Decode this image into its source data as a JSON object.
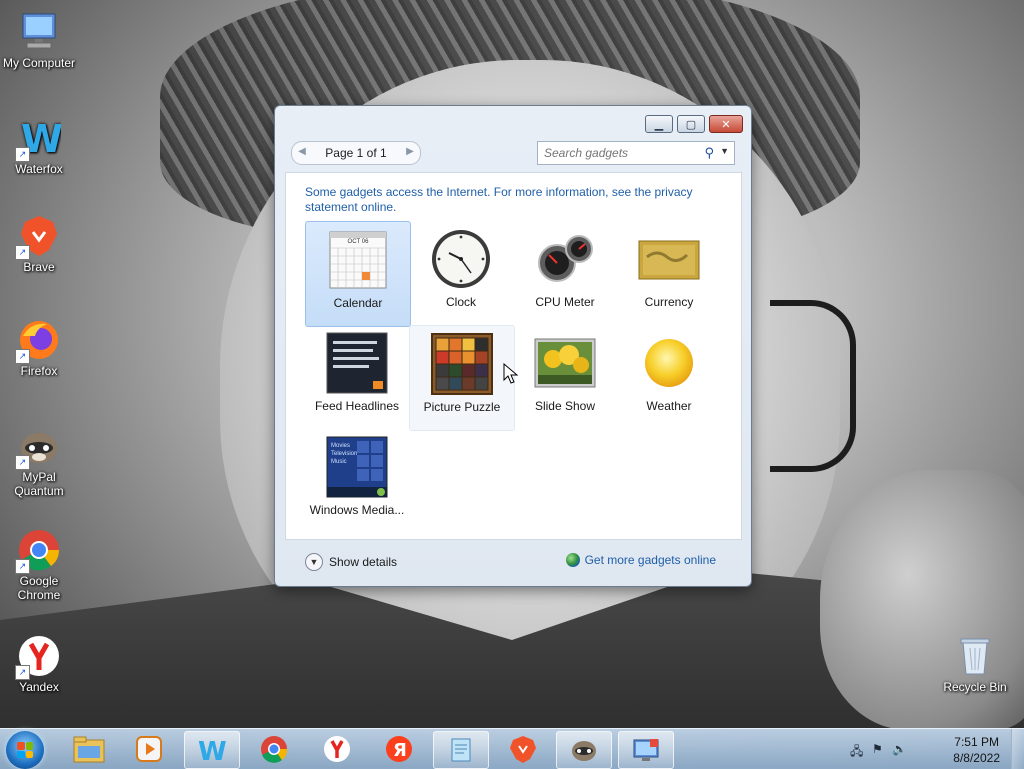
{
  "desktop": {
    "icons": [
      {
        "label": "My Computer"
      },
      {
        "label": "Waterfox"
      },
      {
        "label": "Brave"
      },
      {
        "label": "Firefox"
      },
      {
        "label": "MyPal Quantum"
      },
      {
        "label": "Google Chrome"
      },
      {
        "label": "Yandex"
      },
      {
        "label": "Recycle Bin"
      }
    ]
  },
  "gadget_window": {
    "pager": {
      "label": "Page 1 of 1"
    },
    "search": {
      "placeholder": "Search gadgets"
    },
    "info_text": "Some gadgets access the Internet.  For more information, see the privacy statement online.",
    "gadgets": [
      {
        "label": "Calendar",
        "icon": "calendar-icon",
        "selected": true
      },
      {
        "label": "Clock",
        "icon": "clock-icon"
      },
      {
        "label": "CPU Meter",
        "icon": "cpu-meter-icon"
      },
      {
        "label": "Currency",
        "icon": "currency-icon"
      },
      {
        "label": "Feed Headlines",
        "icon": "feed-headlines-icon"
      },
      {
        "label": "Picture Puzzle",
        "icon": "picture-puzzle-icon",
        "hovered": true
      },
      {
        "label": "Slide Show",
        "icon": "slide-show-icon"
      },
      {
        "label": "Weather",
        "icon": "weather-icon"
      },
      {
        "label": "Windows Media...",
        "icon": "windows-media-icon"
      }
    ],
    "calendar_month": "OCT 06",
    "media_lines": [
      "Movies",
      "Television",
      "Music"
    ],
    "show_details": "Show details",
    "get_more": "Get more gadgets online"
  },
  "taskbar": {
    "pinned": [
      "File Explorer",
      "Media Player",
      "Waterfox",
      "Google Chrome",
      "Yandex",
      "Yandex Browser",
      "Notepad",
      "Brave",
      "MyPal Quantum",
      "Desktop Gadgets"
    ],
    "clock": {
      "time": "7:51 PM",
      "date": "8/8/2022"
    }
  },
  "colors": {
    "link": "#1f5fa8",
    "selection": "#c5ddf8"
  }
}
